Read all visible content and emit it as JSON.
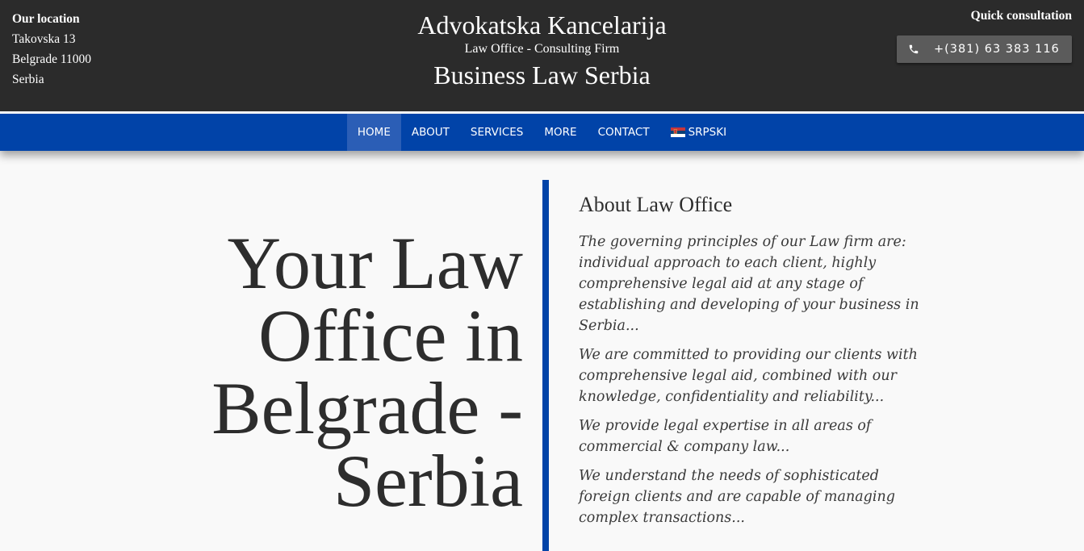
{
  "header": {
    "location_title": "Our location",
    "address": [
      "Takovska 13",
      "Belgrade 11000",
      "Serbia"
    ],
    "brand_title": "Advokatska Kancelarija",
    "brand_subtitle": "Law Office - Consulting Firm",
    "brand_tagline": "Business Law Serbia",
    "quick_title": "Quick consultation",
    "phone": "+(381) 63 383 116",
    "phone_icon": "phone-icon"
  },
  "nav": {
    "items": [
      {
        "label": "HOME",
        "active": true
      },
      {
        "label": "ABOUT"
      },
      {
        "label": "SERVICES"
      },
      {
        "label": "MORE"
      },
      {
        "label": "CONTACT"
      },
      {
        "label": "SRPSKI",
        "icon": "serbia-flag-icon"
      }
    ]
  },
  "hero": {
    "lines": [
      "Your Law",
      "Office in",
      "Belgrade -",
      "Serbia"
    ]
  },
  "about": {
    "title": "About Law Office",
    "paragraphs": [
      "The governing principles of our Law firm are: individual approach to each client, highly comprehensive legal aid at any stage of establishing and developing of your business in Serbia...",
      "We are committed to providing our clients with comprehensive legal aid, combined with our knowledge, confidentiality and reliability...",
      "We provide legal expertise in all areas of commercial & company law...",
      "We understand the needs of sophisticated foreign clients and are capable of managing complex transactions..."
    ]
  },
  "colors": {
    "topbar": "#2b2b2b",
    "nav": "#0143a8",
    "nav_active": "#2b5eb6",
    "accent_line": "#0143a8",
    "page_bg": "#f9f9f9"
  }
}
